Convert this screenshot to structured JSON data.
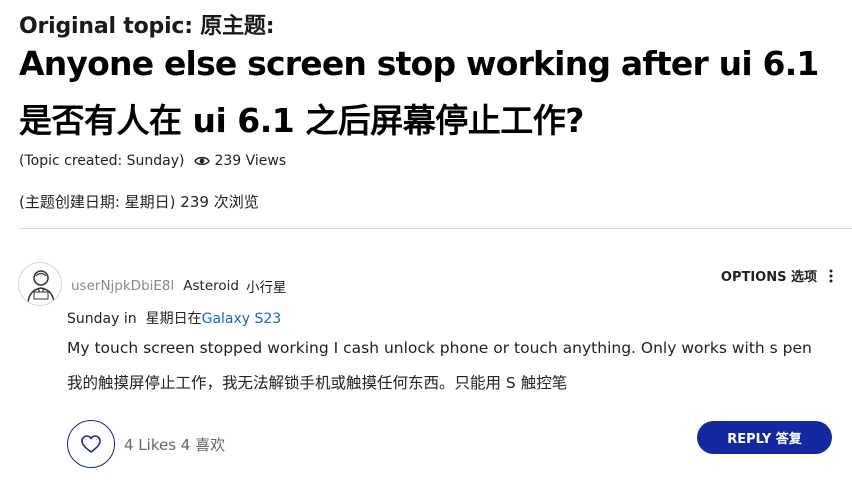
{
  "topic": {
    "original_label": "Original topic: 原主题:",
    "title_en": "Anyone else screen stop working after ui 6.1",
    "title_zh": "是否有人在 ui 6.1 之后屏幕停止工作?",
    "created": "(Topic created: Sunday)",
    "views": "239 Views",
    "meta_zh": "(主题创建日期: 星期日) 239 次浏览"
  },
  "post": {
    "username": "userNjpkDbiE8l",
    "rank": "Asteroid",
    "rank_zh": "小行星",
    "options_label": "OPTIONS 选项",
    "date_prefix": "Sunday in",
    "date_zh": "星期日在",
    "board": "Galaxy S23",
    "body_en": "My touch screen stopped working I cash unlock phone or touch anything. Only works with s pen",
    "body_zh": "我的触摸屏停止工作，我无法解锁手机或触摸任何东西。只能用 S 触控笔",
    "likes": "4 Likes 4 喜欢",
    "reply_label": "REPLY 答复"
  },
  "icons": {
    "views": "eye-icon",
    "options": "vertical-dots-icon",
    "like": "heart-icon",
    "avatar": "user-avatar-icon"
  },
  "colors": {
    "brand": "#1428a0",
    "link": "#1a62d8",
    "username": "#8a8a8a"
  }
}
